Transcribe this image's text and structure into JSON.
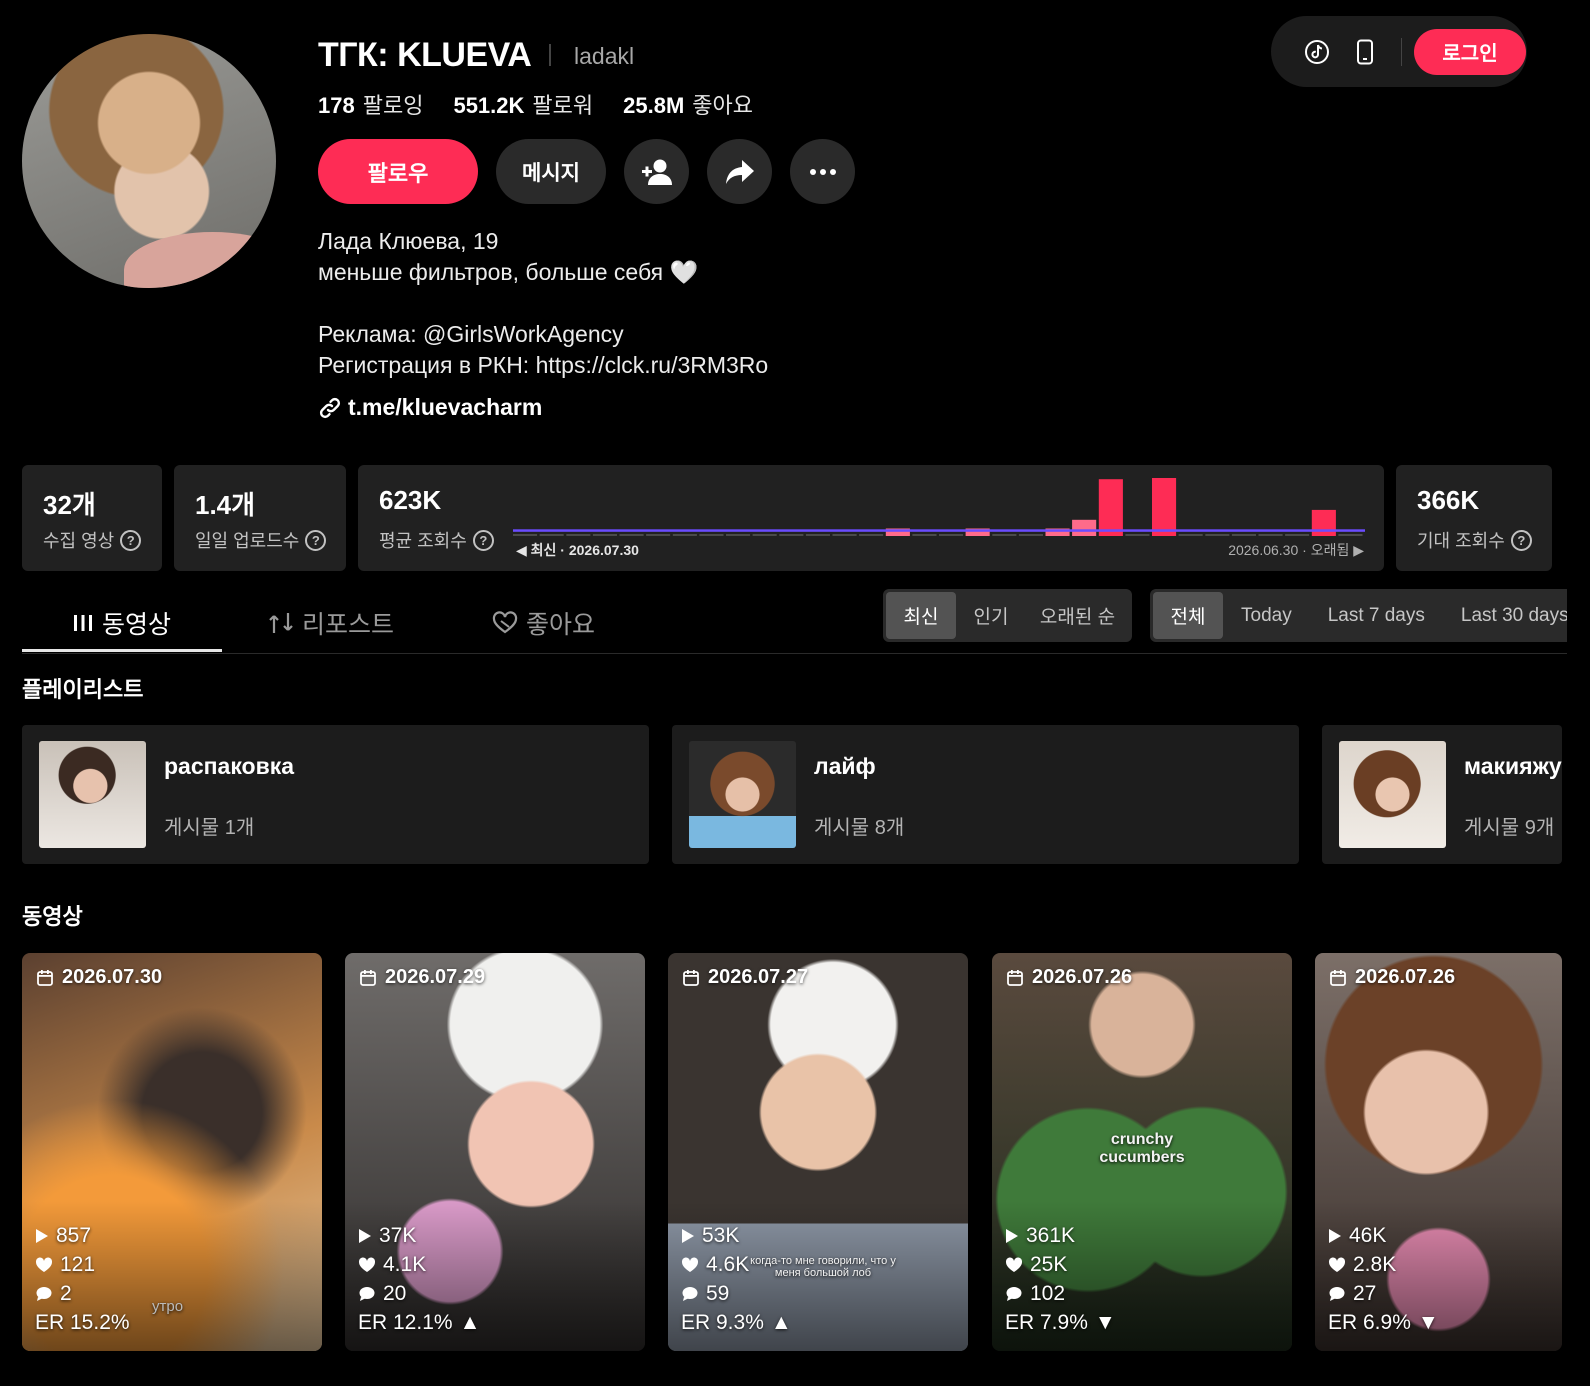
{
  "profile": {
    "name": "ТГК: KLUEVA",
    "handle": "ladakl",
    "following_count": "178",
    "following_label": "팔로잉",
    "followers_count": "551.2K",
    "followers_label": "팔로워",
    "likes_count": "25.8M",
    "likes_label": "좋아요",
    "follow_label": "팔로우",
    "message_label": "메시지",
    "bio": [
      "Лада Клюева, 19",
      "меньше фильтров, больше себя 🤍",
      "",
      "Реклама: @GirlsWorkAgency",
      "Регистрация в РКН: https://clck.ru/3RM3Ro"
    ],
    "link": "t.me/kluevacharm"
  },
  "topbar": {
    "login_label": "로그인"
  },
  "analytics": {
    "collected": {
      "value": "32개",
      "label": "수집 영상"
    },
    "daily_uploads": {
      "value": "1.4개",
      "label": "일일 업로드수"
    },
    "avg_views": {
      "value": "623K",
      "label": "평균 조회수",
      "axis_left": "최신 · 2026.07.30",
      "axis_right": "2026.06.30 · 오래됨"
    },
    "expected_views": {
      "value": "366K",
      "label": "기대 조회수"
    },
    "colors": {
      "high": "#fe2c55",
      "low": "#ff6b8a",
      "avg_line": "#6a4cff"
    }
  },
  "chart_data": {
    "type": "bar",
    "x_order": "newest-to-oldest",
    "values_relative": [
      0.03,
      0.03,
      0.03,
      0.03,
      0.03,
      0.03,
      0.03,
      0.03,
      0.03,
      0.03,
      0.03,
      0.03,
      0.03,
      0.03,
      0.13,
      0.03,
      0.03,
      0.13,
      0.03,
      0.03,
      0.13,
      0.28,
      0.98,
      0.03,
      1.0,
      0.03,
      0.03,
      0.03,
      0.03,
      0.03,
      0.45,
      0.03
    ],
    "average_line": 0.18
  },
  "tabs": [
    {
      "label": "동영상",
      "icon": "grid-icon",
      "active": true
    },
    {
      "label": "리포스트",
      "icon": "repost-icon",
      "active": false
    },
    {
      "label": "좋아요",
      "icon": "heart-icon",
      "active": false
    }
  ],
  "sort_options": [
    {
      "label": "최신",
      "selected": true
    },
    {
      "label": "인기",
      "selected": false
    },
    {
      "label": "오래된 순",
      "selected": false
    }
  ],
  "range_options": [
    {
      "label": "전체",
      "selected": true
    },
    {
      "label": "Today",
      "selected": false
    },
    {
      "label": "Last 7 days",
      "selected": false
    },
    {
      "label": "Last 30 days",
      "selected": false
    }
  ],
  "playlists_title": "플레이리스트",
  "playlists": [
    {
      "title": "распаковка",
      "count": "게시물 1개"
    },
    {
      "title": "лайф",
      "count": "게시물 8개"
    },
    {
      "title": "макияжу",
      "count": "게시물 9개"
    }
  ],
  "videos_title": "동영상",
  "videos": [
    {
      "date": "2026.07.30",
      "views": "857",
      "likes": "121",
      "comments": "2",
      "er": "ER 15.2%",
      "trend": "",
      "caption": "утро"
    },
    {
      "date": "2026.07.29",
      "views": "37K",
      "likes": "4.1K",
      "comments": "20",
      "er": "ER 12.1%",
      "trend": "▲",
      "caption": ""
    },
    {
      "date": "2026.07.27",
      "views": "53K",
      "likes": "4.6K",
      "comments": "59",
      "er": "ER 9.3%",
      "trend": "▲",
      "caption": "когда-то мне говорили, что у меня большой лоб"
    },
    {
      "date": "2026.07.26",
      "views": "361K",
      "likes": "25K",
      "comments": "102",
      "er": "ER 7.9%",
      "trend": "▼",
      "caption": "crunchy cucumbers"
    },
    {
      "date": "2026.07.26",
      "views": "46K",
      "likes": "2.8K",
      "comments": "27",
      "er": "ER 6.9%",
      "trend": "▼",
      "caption": ""
    }
  ]
}
